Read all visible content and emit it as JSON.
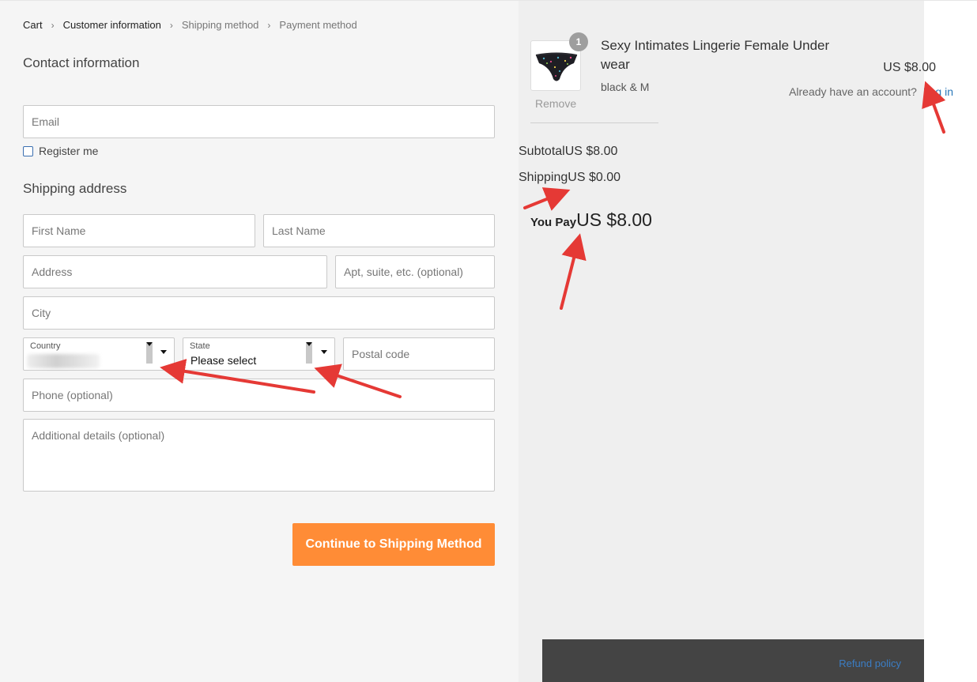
{
  "breadcrumb": {
    "items": [
      "Cart",
      "Customer information",
      "Shipping method",
      "Payment method"
    ]
  },
  "contact": {
    "title": "Contact information",
    "account_prompt": "Already have an account?",
    "login_label": "Log in",
    "email_placeholder": "Email",
    "register_label": "Register me"
  },
  "shipping": {
    "title": "Shipping address",
    "first_name_placeholder": "First Name",
    "last_name_placeholder": "Last Name",
    "address_placeholder": "Address",
    "apt_placeholder": "Apt, suite, etc. (optional)",
    "city_placeholder": "City",
    "country_label": "Country",
    "state_label": "State",
    "state_value": "Please select",
    "postal_placeholder": "Postal code",
    "phone_placeholder": "Phone (optional)",
    "details_placeholder": "Additional details (optional)"
  },
  "cta": {
    "label": "Continue to Shipping Method"
  },
  "order": {
    "quantity": "1",
    "product_name": "Sexy Intimates Lingerie Female Underwear",
    "variant": "black & M",
    "price": "US $8.00",
    "remove_label": "Remove",
    "subtotal_label": "Subtotal",
    "subtotal_value": "US $8.00",
    "shipping_label": "Shipping",
    "shipping_value": "US $0.00",
    "total_label": "You Pay",
    "total_value": "US $8.00"
  },
  "footer": {
    "refund_label": "Refund policy"
  },
  "colors": {
    "accent_button": "#ff8c36",
    "link": "#2b78b9",
    "annotation_arrow": "#e53935",
    "footer_bg": "#444444"
  }
}
